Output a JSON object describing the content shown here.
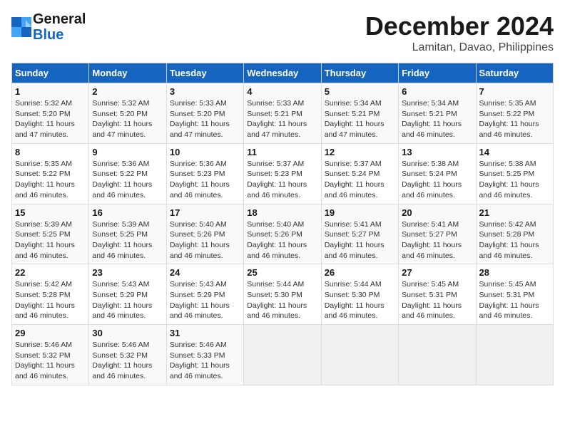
{
  "header": {
    "logo_line1": "General",
    "logo_line2": "Blue",
    "month": "December 2024",
    "location": "Lamitan, Davao, Philippines"
  },
  "weekdays": [
    "Sunday",
    "Monday",
    "Tuesday",
    "Wednesday",
    "Thursday",
    "Friday",
    "Saturday"
  ],
  "weeks": [
    [
      {
        "day": "1",
        "info": "Sunrise: 5:32 AM\nSunset: 5:20 PM\nDaylight: 11 hours\nand 47 minutes."
      },
      {
        "day": "2",
        "info": "Sunrise: 5:32 AM\nSunset: 5:20 PM\nDaylight: 11 hours\nand 47 minutes."
      },
      {
        "day": "3",
        "info": "Sunrise: 5:33 AM\nSunset: 5:20 PM\nDaylight: 11 hours\nand 47 minutes."
      },
      {
        "day": "4",
        "info": "Sunrise: 5:33 AM\nSunset: 5:21 PM\nDaylight: 11 hours\nand 47 minutes."
      },
      {
        "day": "5",
        "info": "Sunrise: 5:34 AM\nSunset: 5:21 PM\nDaylight: 11 hours\nand 47 minutes."
      },
      {
        "day": "6",
        "info": "Sunrise: 5:34 AM\nSunset: 5:21 PM\nDaylight: 11 hours\nand 46 minutes."
      },
      {
        "day": "7",
        "info": "Sunrise: 5:35 AM\nSunset: 5:22 PM\nDaylight: 11 hours\nand 46 minutes."
      }
    ],
    [
      {
        "day": "8",
        "info": "Sunrise: 5:35 AM\nSunset: 5:22 PM\nDaylight: 11 hours\nand 46 minutes."
      },
      {
        "day": "9",
        "info": "Sunrise: 5:36 AM\nSunset: 5:22 PM\nDaylight: 11 hours\nand 46 minutes."
      },
      {
        "day": "10",
        "info": "Sunrise: 5:36 AM\nSunset: 5:23 PM\nDaylight: 11 hours\nand 46 minutes."
      },
      {
        "day": "11",
        "info": "Sunrise: 5:37 AM\nSunset: 5:23 PM\nDaylight: 11 hours\nand 46 minutes."
      },
      {
        "day": "12",
        "info": "Sunrise: 5:37 AM\nSunset: 5:24 PM\nDaylight: 11 hours\nand 46 minutes."
      },
      {
        "day": "13",
        "info": "Sunrise: 5:38 AM\nSunset: 5:24 PM\nDaylight: 11 hours\nand 46 minutes."
      },
      {
        "day": "14",
        "info": "Sunrise: 5:38 AM\nSunset: 5:25 PM\nDaylight: 11 hours\nand 46 minutes."
      }
    ],
    [
      {
        "day": "15",
        "info": "Sunrise: 5:39 AM\nSunset: 5:25 PM\nDaylight: 11 hours\nand 46 minutes."
      },
      {
        "day": "16",
        "info": "Sunrise: 5:39 AM\nSunset: 5:25 PM\nDaylight: 11 hours\nand 46 minutes."
      },
      {
        "day": "17",
        "info": "Sunrise: 5:40 AM\nSunset: 5:26 PM\nDaylight: 11 hours\nand 46 minutes."
      },
      {
        "day": "18",
        "info": "Sunrise: 5:40 AM\nSunset: 5:26 PM\nDaylight: 11 hours\nand 46 minutes."
      },
      {
        "day": "19",
        "info": "Sunrise: 5:41 AM\nSunset: 5:27 PM\nDaylight: 11 hours\nand 46 minutes."
      },
      {
        "day": "20",
        "info": "Sunrise: 5:41 AM\nSunset: 5:27 PM\nDaylight: 11 hours\nand 46 minutes."
      },
      {
        "day": "21",
        "info": "Sunrise: 5:42 AM\nSunset: 5:28 PM\nDaylight: 11 hours\nand 46 minutes."
      }
    ],
    [
      {
        "day": "22",
        "info": "Sunrise: 5:42 AM\nSunset: 5:28 PM\nDaylight: 11 hours\nand 46 minutes."
      },
      {
        "day": "23",
        "info": "Sunrise: 5:43 AM\nSunset: 5:29 PM\nDaylight: 11 hours\nand 46 minutes."
      },
      {
        "day": "24",
        "info": "Sunrise: 5:43 AM\nSunset: 5:29 PM\nDaylight: 11 hours\nand 46 minutes."
      },
      {
        "day": "25",
        "info": "Sunrise: 5:44 AM\nSunset: 5:30 PM\nDaylight: 11 hours\nand 46 minutes."
      },
      {
        "day": "26",
        "info": "Sunrise: 5:44 AM\nSunset: 5:30 PM\nDaylight: 11 hours\nand 46 minutes."
      },
      {
        "day": "27",
        "info": "Sunrise: 5:45 AM\nSunset: 5:31 PM\nDaylight: 11 hours\nand 46 minutes."
      },
      {
        "day": "28",
        "info": "Sunrise: 5:45 AM\nSunset: 5:31 PM\nDaylight: 11 hours\nand 46 minutes."
      }
    ],
    [
      {
        "day": "29",
        "info": "Sunrise: 5:46 AM\nSunset: 5:32 PM\nDaylight: 11 hours\nand 46 minutes."
      },
      {
        "day": "30",
        "info": "Sunrise: 5:46 AM\nSunset: 5:32 PM\nDaylight: 11 hours\nand 46 minutes."
      },
      {
        "day": "31",
        "info": "Sunrise: 5:46 AM\nSunset: 5:33 PM\nDaylight: 11 hours\nand 46 minutes."
      },
      {
        "day": "",
        "info": ""
      },
      {
        "day": "",
        "info": ""
      },
      {
        "day": "",
        "info": ""
      },
      {
        "day": "",
        "info": ""
      }
    ]
  ]
}
